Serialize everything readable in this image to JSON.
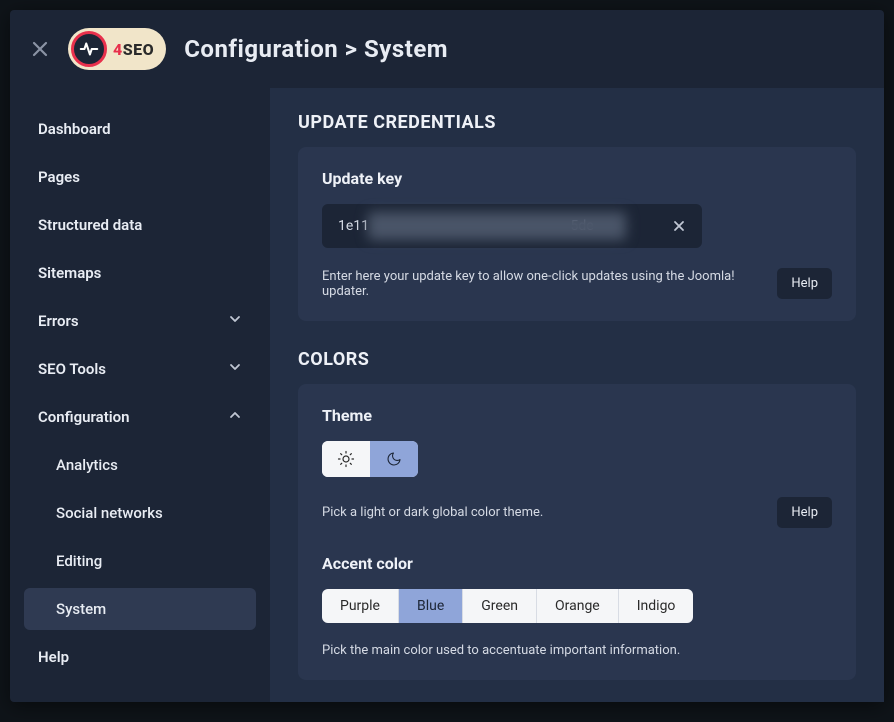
{
  "header": {
    "logo": {
      "prefix": "4",
      "suffix": "SEO"
    },
    "breadcrumb": "Configuration > System"
  },
  "sidebar": {
    "items": [
      {
        "label": "Dashboard",
        "type": "link"
      },
      {
        "label": "Pages",
        "type": "link"
      },
      {
        "label": "Structured data",
        "type": "link"
      },
      {
        "label": "Sitemaps",
        "type": "link"
      },
      {
        "label": "Errors",
        "type": "collapse",
        "open": false
      },
      {
        "label": "SEO Tools",
        "type": "collapse",
        "open": false
      },
      {
        "label": "Configuration",
        "type": "collapse",
        "open": true
      },
      {
        "label": "Analytics",
        "type": "sub"
      },
      {
        "label": "Social networks",
        "type": "sub"
      },
      {
        "label": "Editing",
        "type": "sub"
      },
      {
        "label": "System",
        "type": "sub",
        "active": true
      },
      {
        "label": "Help",
        "type": "link"
      }
    ]
  },
  "main": {
    "update_section": {
      "title": "UPDATE CREDENTIALS",
      "field_label": "Update key",
      "value_prefix": "1e11",
      "value_suffix": "5de",
      "help_text": "Enter here your update key to allow one-click updates using the Joomla! updater.",
      "help_btn": "Help"
    },
    "colors_section": {
      "title": "COLORS",
      "theme": {
        "label": "Theme",
        "options": [
          "light",
          "dark"
        ],
        "selected": "dark",
        "help_text": "Pick a light or dark global color theme.",
        "help_btn": "Help"
      },
      "accent": {
        "label": "Accent color",
        "options": [
          "Purple",
          "Blue",
          "Green",
          "Orange",
          "Indigo"
        ],
        "selected": "Blue",
        "help_text": "Pick the main color used to accentuate important information."
      }
    }
  }
}
